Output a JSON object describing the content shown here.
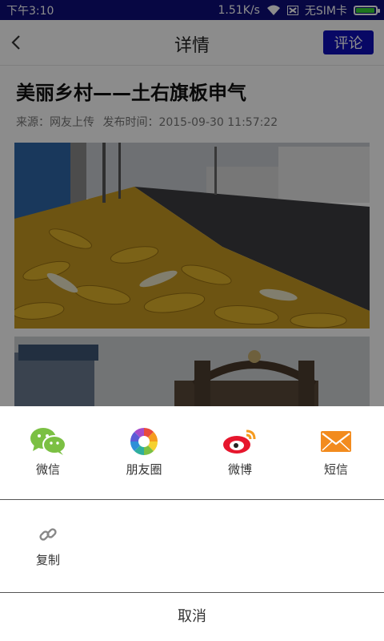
{
  "status": {
    "time": "下午3:10",
    "speed": "1.51K/s",
    "sim": "无SIM卡",
    "battery_fraction": 0.9
  },
  "header": {
    "title": "详情",
    "comment_label": "评论"
  },
  "article": {
    "title": "美丽乡村——土右旗板申气",
    "source_label": "来源：网友上传",
    "time_label": "发布时间：2015-09-30 11:57:22"
  },
  "share": {
    "items": [
      {
        "label": "微信",
        "icon": "wechat-icon"
      },
      {
        "label": "朋友圈",
        "icon": "moments-icon"
      },
      {
        "label": "微博",
        "icon": "weibo-icon"
      },
      {
        "label": "短信",
        "icon": "sms-icon"
      }
    ],
    "copy_label": "复制",
    "cancel_label": "取消"
  },
  "colors": {
    "statusbar": "#0d0d7a",
    "accent": "#1010b8",
    "wechat": "#7bc043",
    "sms": "#f28b1e",
    "weibo": "#e6162d"
  }
}
